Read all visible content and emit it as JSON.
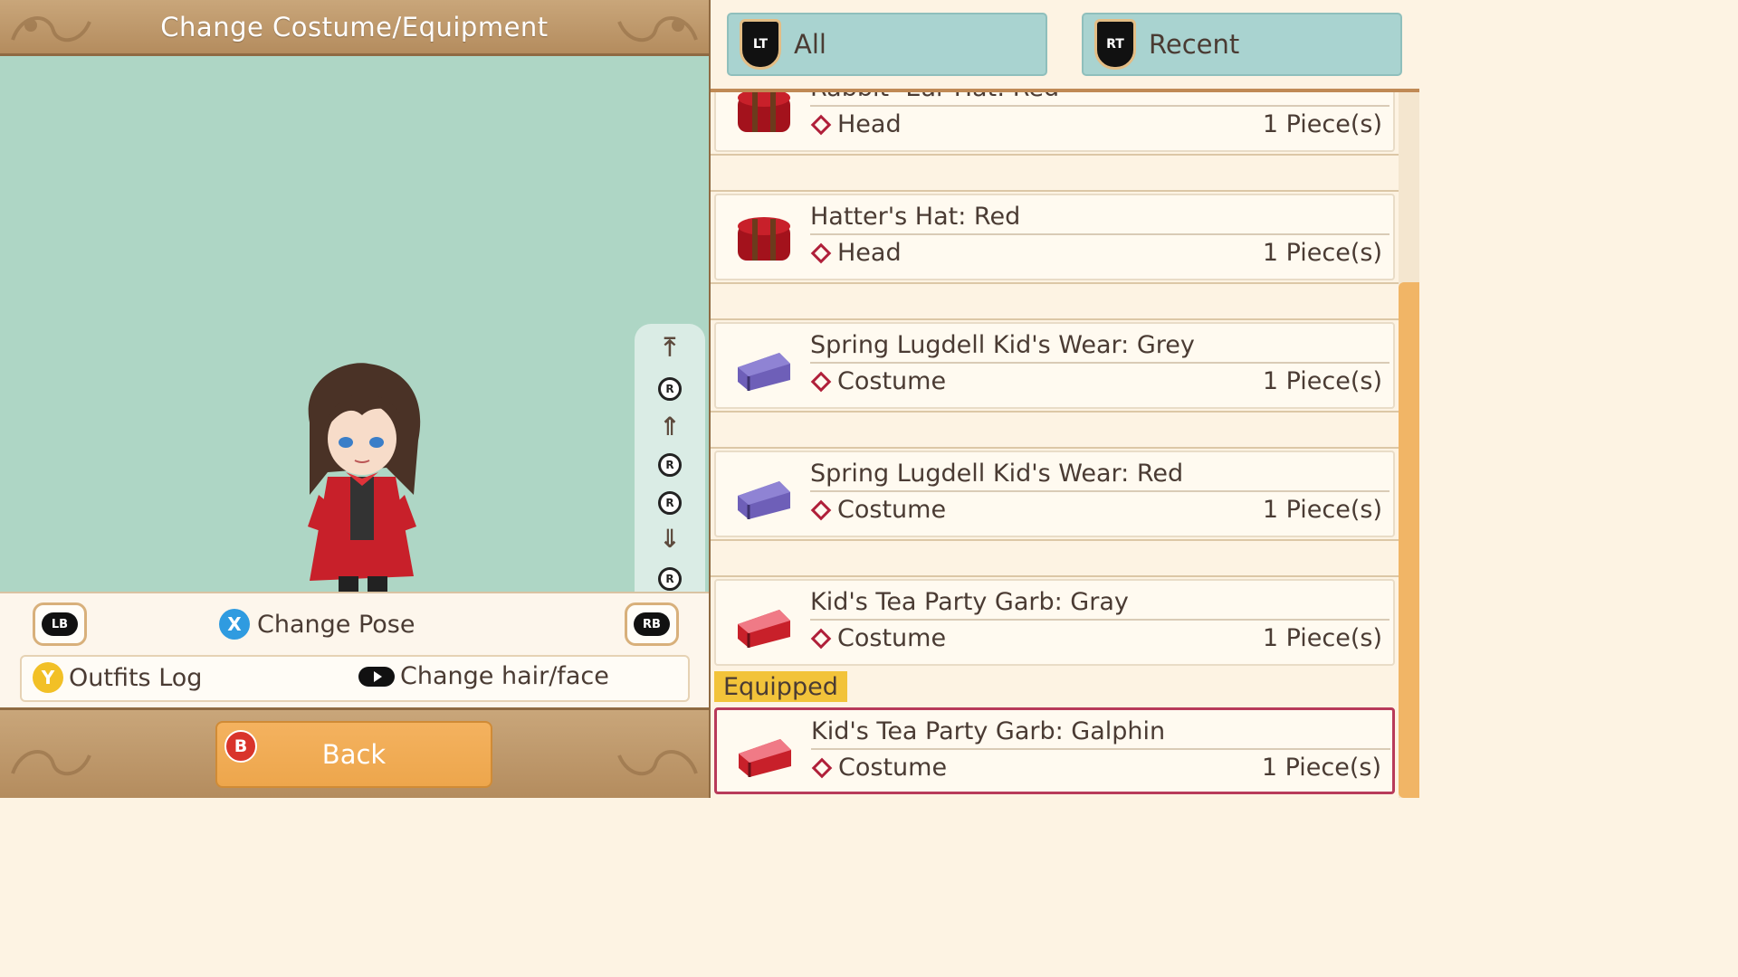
{
  "header": {
    "title": "Change Costume/Equipment"
  },
  "camera_controls": {
    "buttons": [
      "jump-top",
      "rotate-up",
      "move-up",
      "rotate-left",
      "rotate-right",
      "move-down",
      "rotate-down",
      "jump-bottom"
    ],
    "r_label": "R"
  },
  "controls": {
    "lb_label": "LB",
    "rb_label": "RB",
    "change_pose": {
      "key": "X",
      "label": "Change Pose",
      "color": "#2f9be0"
    },
    "outfits_log": {
      "key": "Y",
      "label": "Outfits Log",
      "color": "#f2c026"
    },
    "change_hair_face": {
      "label": "Change hair/face"
    }
  },
  "footer": {
    "back": {
      "key": "B",
      "label": "Back",
      "key_color": "#d9342b"
    }
  },
  "tabs": [
    {
      "key": "LT",
      "label": "All"
    },
    {
      "key": "RT",
      "label": "Recent"
    }
  ],
  "items": [
    {
      "name": "Rabbit- Ear Hat: Red",
      "category": "Head",
      "quantity": "1 Piece(s)",
      "icon": "hatbox-red-icon"
    },
    {
      "name": "Hatter's Hat: Red",
      "category": "Head",
      "quantity": "1 Piece(s)",
      "icon": "hatbox-red-icon"
    },
    {
      "name": "Spring Lugdell Kid's Wear: Grey",
      "category": "Costume",
      "quantity": "1 Piece(s)",
      "icon": "suitcase-purple-icon"
    },
    {
      "name": "Spring Lugdell Kid's Wear: Red",
      "category": "Costume",
      "quantity": "1 Piece(s)",
      "icon": "suitcase-purple-icon"
    },
    {
      "name": "Kid's Tea Party Garb: Gray",
      "category": "Costume",
      "quantity": "1 Piece(s)",
      "icon": "suitcase-pink-icon"
    },
    {
      "name": "Kid's Tea Party Garb: Galphin",
      "category": "Costume",
      "quantity": "1 Piece(s)",
      "icon": "suitcase-pink-icon",
      "equipped": true
    }
  ],
  "equipped_label": "Equipped",
  "colors": {
    "accent": "#f1b566",
    "tab": "#a9d3d0",
    "preview_bg": "#aed6c5",
    "equipped_border": "#b83a5a"
  }
}
